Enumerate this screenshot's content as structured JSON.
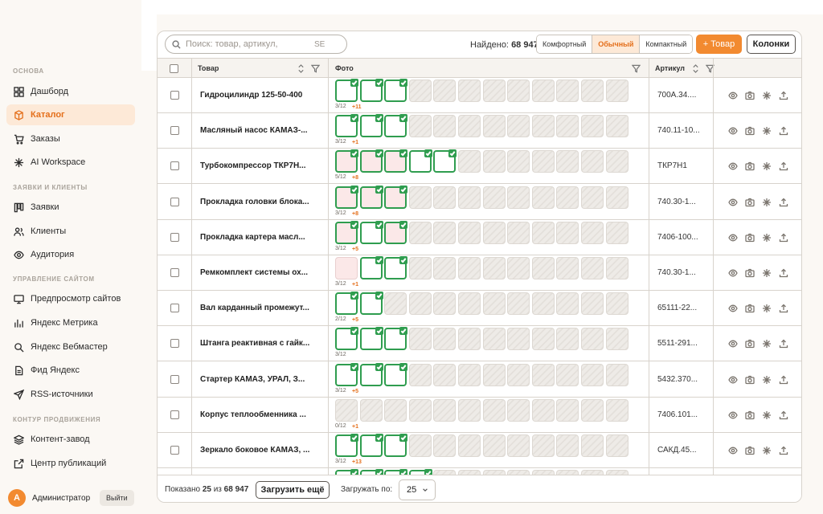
{
  "sidebar": {
    "sections": [
      "ОСНОВА",
      "ЗАЯВКИ И КЛИЕНТЫ",
      "УПРАВЛЕНИЕ САЙТОМ",
      "КОНТУР ПРОДВИЖЕНИЯ"
    ],
    "items": [
      {
        "label": "Дашборд",
        "icon": "dashboard-icon"
      },
      {
        "label": "Каталог",
        "icon": "catalog-icon",
        "active": true
      },
      {
        "label": "Заказы",
        "icon": "cart-icon"
      },
      {
        "label": "AI Workspace",
        "icon": "sparkle-icon"
      },
      {
        "label": "Заявки",
        "icon": "kanban-icon"
      },
      {
        "label": "Клиенты",
        "icon": "users-icon"
      },
      {
        "label": "Аудитория",
        "icon": "eye-icon"
      },
      {
        "label": "Предпросмотр сайтов",
        "icon": "monitor-icon"
      },
      {
        "label": "Яндекс Метрика",
        "icon": "bar-chart-icon"
      },
      {
        "label": "Яндекс Вебмастер",
        "icon": "search-icon"
      },
      {
        "label": "Фид Яндекс",
        "icon": "share-icon"
      },
      {
        "label": "RSS-источники",
        "icon": "send-icon"
      },
      {
        "label": "Контент-завод",
        "icon": "layers-icon"
      },
      {
        "label": "Центр публикаций",
        "icon": "external-link-icon"
      }
    ],
    "user": {
      "initial": "А",
      "name": "Администратор",
      "logout": "Выйти"
    }
  },
  "toolbar": {
    "search_placeholder": "Поиск: товар, артикул,",
    "search_hint": "SE",
    "found_label": "Найдено:",
    "found_count": "68 947",
    "density": [
      "Комфортный",
      "Обычный",
      "Компактный"
    ],
    "density_active": "Обычный",
    "add_label": "+ Товар",
    "columns_label": "Колонки"
  },
  "table": {
    "headers": {
      "product": "Товар",
      "photo": "Фото",
      "article": "Артикул"
    },
    "photo_slots": 12,
    "rows": [
      {
        "name": "Гидроцилиндр 125-50-400",
        "photos": 3,
        "count": "3/12",
        "extra": "+11",
        "article": "700А.34...."
      },
      {
        "name": "Масляный насос КАМАЗ-...",
        "photos": 3,
        "count": "3/12",
        "extra": "+1",
        "article": "740.11-10..."
      },
      {
        "name": "Турбокомпрессор ТКР7Н...",
        "photos": 5,
        "count": "5/12",
        "extra": "+8",
        "article": "ТКР7Н1",
        "pink": [
          0,
          1,
          2
        ]
      },
      {
        "name": "Прокладка головки блока...",
        "photos": 3,
        "count": "3/12",
        "extra": "+8",
        "article": "740.30-1...",
        "pink": [
          0,
          1,
          2
        ]
      },
      {
        "name": "Прокладка картера масл...",
        "photos": 3,
        "count": "3/12",
        "extra": "+5",
        "article": "7406-100...",
        "pink": [
          0,
          2
        ]
      },
      {
        "name": "Ремкомплект системы ох...",
        "photos": 3,
        "count": "3/12",
        "extra": "+1",
        "article": "740.30-1...",
        "pinkfirst": true
      },
      {
        "name": "Вал карданный промежут...",
        "photos": 2,
        "count": "2/12",
        "extra": "+5",
        "article": "65111-22..."
      },
      {
        "name": "Штанга реактивная с гайк...",
        "photos": 3,
        "count": "3/12",
        "extra": "",
        "article": "5511-291..."
      },
      {
        "name": "Стартер КАМАЗ, УРАЛ, З...",
        "photos": 3,
        "count": "3/12",
        "extra": "+5",
        "article": "5432.370..."
      },
      {
        "name": "Корпус теплообменника ...",
        "photos": 0,
        "count": "0/12",
        "extra": "+1",
        "article": "7406.101..."
      },
      {
        "name": "Зеркало боковое КАМАЗ, ...",
        "photos": 3,
        "count": "3/12",
        "extra": "+13",
        "article": "САКД.45..."
      },
      {
        "name": "",
        "photos": 4,
        "count": "",
        "extra": "",
        "article": ""
      }
    ]
  },
  "footer": {
    "shown_label": "Показано",
    "shown_count": "25",
    "of_label": "из",
    "total": "68 947",
    "load_more": "Загрузить ещё",
    "per_page_label": "Загружать по:",
    "per_page_value": "25"
  },
  "colors": {
    "accent": "#f28a30",
    "success": "#2f9d4f",
    "active_bg": "#fde9d7"
  }
}
